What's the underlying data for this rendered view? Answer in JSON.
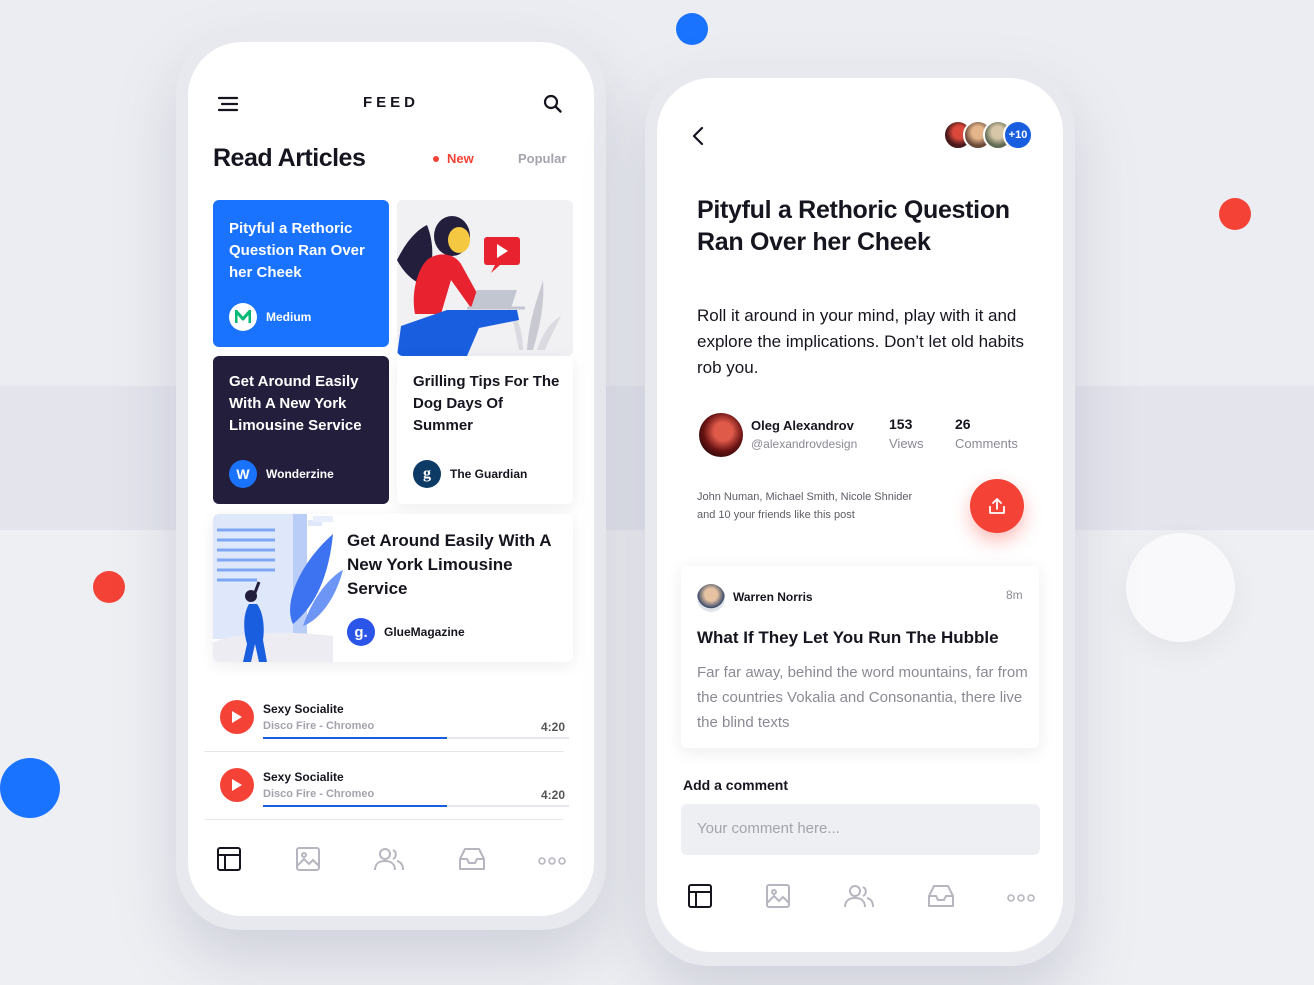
{
  "feed": {
    "title": "FEED",
    "heading": "Read Articles",
    "filters": {
      "active": "New",
      "inactive": "Popular"
    },
    "articles": [
      {
        "title": "Pityful a Rethoric Question Ran Over her Cheek",
        "source": "Medium",
        "logo": "M"
      },
      {
        "title": "Get Around Easily With A New York Limousine Service",
        "source": "Wonderzine",
        "logo": "W"
      },
      {
        "title": "Grilling Tips For The Dog Days Of Summer",
        "source": "The Guardian",
        "logo": "g"
      },
      {
        "title": "Get Around Easily With A New York Limousine Service",
        "source": "GlueMagazine",
        "logo": "g."
      }
    ],
    "tracks": [
      {
        "title": "Sexy Socialite",
        "artist": "Disco Fire - Chromeo",
        "duration": "4:20",
        "progress": 0.6
      },
      {
        "title": "Sexy Socialite",
        "artist": "Disco Fire - Chromeo",
        "duration": "4:20",
        "progress": 0.6
      }
    ]
  },
  "article": {
    "participants_extra": "+10",
    "title": "Pityful a Rethoric Question Ran Over her Cheek",
    "lead": "Roll it around in your mind, play with it and explore the implications. Don’t let old habits rob you.",
    "author": {
      "name": "Oleg Alexandrov",
      "handle": "@alexandrovdesign"
    },
    "stats": {
      "views_value": "153",
      "views_label": "Views",
      "comments_value": "26",
      "comments_label": "Comments"
    },
    "likes_line1": "John Numan, Michael Smith, Nicole Shnider",
    "likes_line2": "and 10 your friends like this post",
    "comment": {
      "author": "Warren Norris",
      "time": "8m",
      "title": "What If They Let You Run The Hubble",
      "body": "Far far away, behind the word mountains, far from the countries Vokalia and Consonantia, there live the blind texts"
    },
    "add_comment_label": "Add a comment",
    "comment_placeholder": "Your comment here..."
  },
  "colors": {
    "blue": "#1a73ff",
    "red": "#f44336",
    "navy": "#221e3c",
    "dark": "#15151f"
  }
}
